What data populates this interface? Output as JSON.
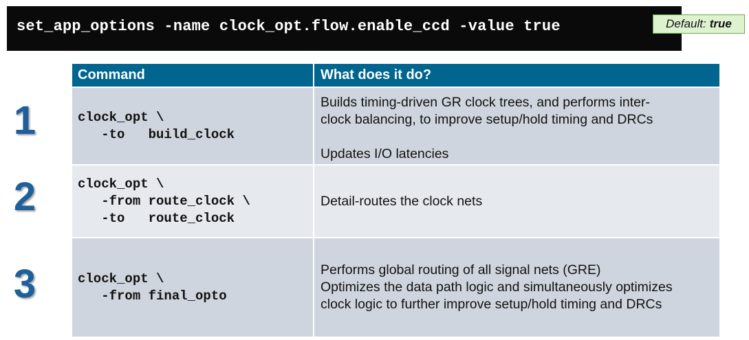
{
  "command_bar": {
    "text": "set_app_options -name clock_opt.flow.enable_ccd -value true",
    "default_label": "Default:",
    "default_value": "true"
  },
  "table": {
    "headers": [
      "Command",
      "What does it do?"
    ],
    "rows": [
      {
        "number": "1",
        "command": "clock_opt \\\n   -to   build_clock",
        "description": "Builds timing-driven GR clock trees, and performs inter-\nclock balancing, to improve setup/hold timing and DRCs\n\nUpdates I/O latencies"
      },
      {
        "number": "2",
        "command": "clock_opt \\\n   -from route_clock \\\n   -to   route_clock",
        "description": "Detail-routes the clock nets"
      },
      {
        "number": "3",
        "command": "clock_opt \\\n   -from final_opto",
        "description": "Performs global routing of all signal nets (GRE)\nOptimizes the data path logic and simultaneously optimizes\nclock logic to further improve setup/hold timing and DRCs"
      }
    ]
  }
}
